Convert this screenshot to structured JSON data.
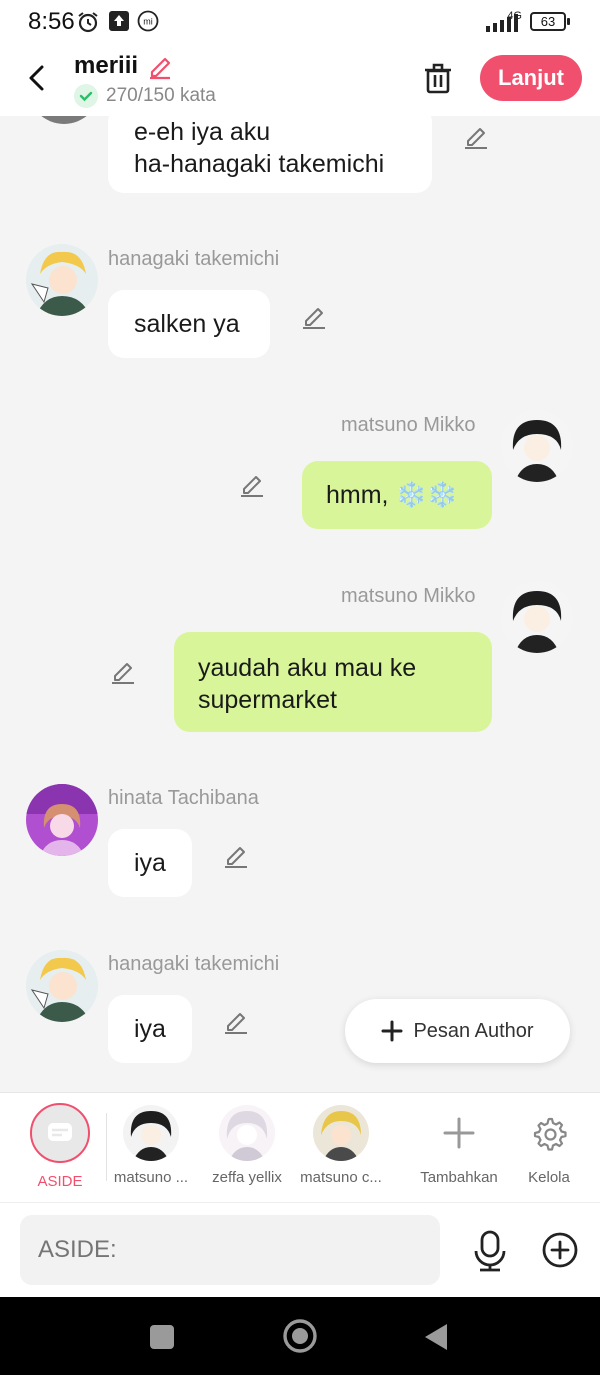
{
  "status_bar": {
    "time": "8:56",
    "network": "4G",
    "battery": "63"
  },
  "header": {
    "title": "meriii",
    "counter": "270/150 kata",
    "lanjut_label": "Lanjut"
  },
  "colors": {
    "accent": "#f0506e",
    "right_bubble": "#d8f59a",
    "left_bubble": "#ffffff",
    "background": "#f4f4f4"
  },
  "messages": [
    {
      "side": "left",
      "sender": "",
      "text": "e-eh iya aku\nha-hanagaki takemichi"
    },
    {
      "side": "left",
      "sender": "hanagaki takemichi",
      "text": "salken ya"
    },
    {
      "side": "right",
      "sender": "matsuno Mikko",
      "text": "hmm, ❄️❄️"
    },
    {
      "side": "right",
      "sender": "matsuno Mikko",
      "text": "yaudah aku mau ke\nsupermarket"
    },
    {
      "side": "left",
      "sender": "hinata Tachibana",
      "text": "iya"
    },
    {
      "side": "left",
      "sender": "hanagaki takemichi",
      "text": "iya"
    }
  ],
  "pesan_author_label": "Pesan Author",
  "characters": {
    "aside_label": "ASIDE",
    "items": [
      {
        "name": "matsuno ..."
      },
      {
        "name": "zeffa yellix"
      },
      {
        "name": "matsuno c..."
      }
    ],
    "add_label": "Tambahkan",
    "manage_label": "Kelola"
  },
  "input": {
    "placeholder": "ASIDE:"
  },
  "icons": [
    "alarm-icon",
    "upload-icon",
    "mi-icon",
    "signal-icon",
    "battery-icon",
    "back-icon",
    "edit-icon",
    "check-icon",
    "trash-icon",
    "pencil-icon",
    "plus-icon",
    "chat-icon",
    "gear-icon",
    "mic-icon",
    "add-circle-icon",
    "square-nav-icon",
    "home-nav-icon",
    "back-nav-icon"
  ]
}
